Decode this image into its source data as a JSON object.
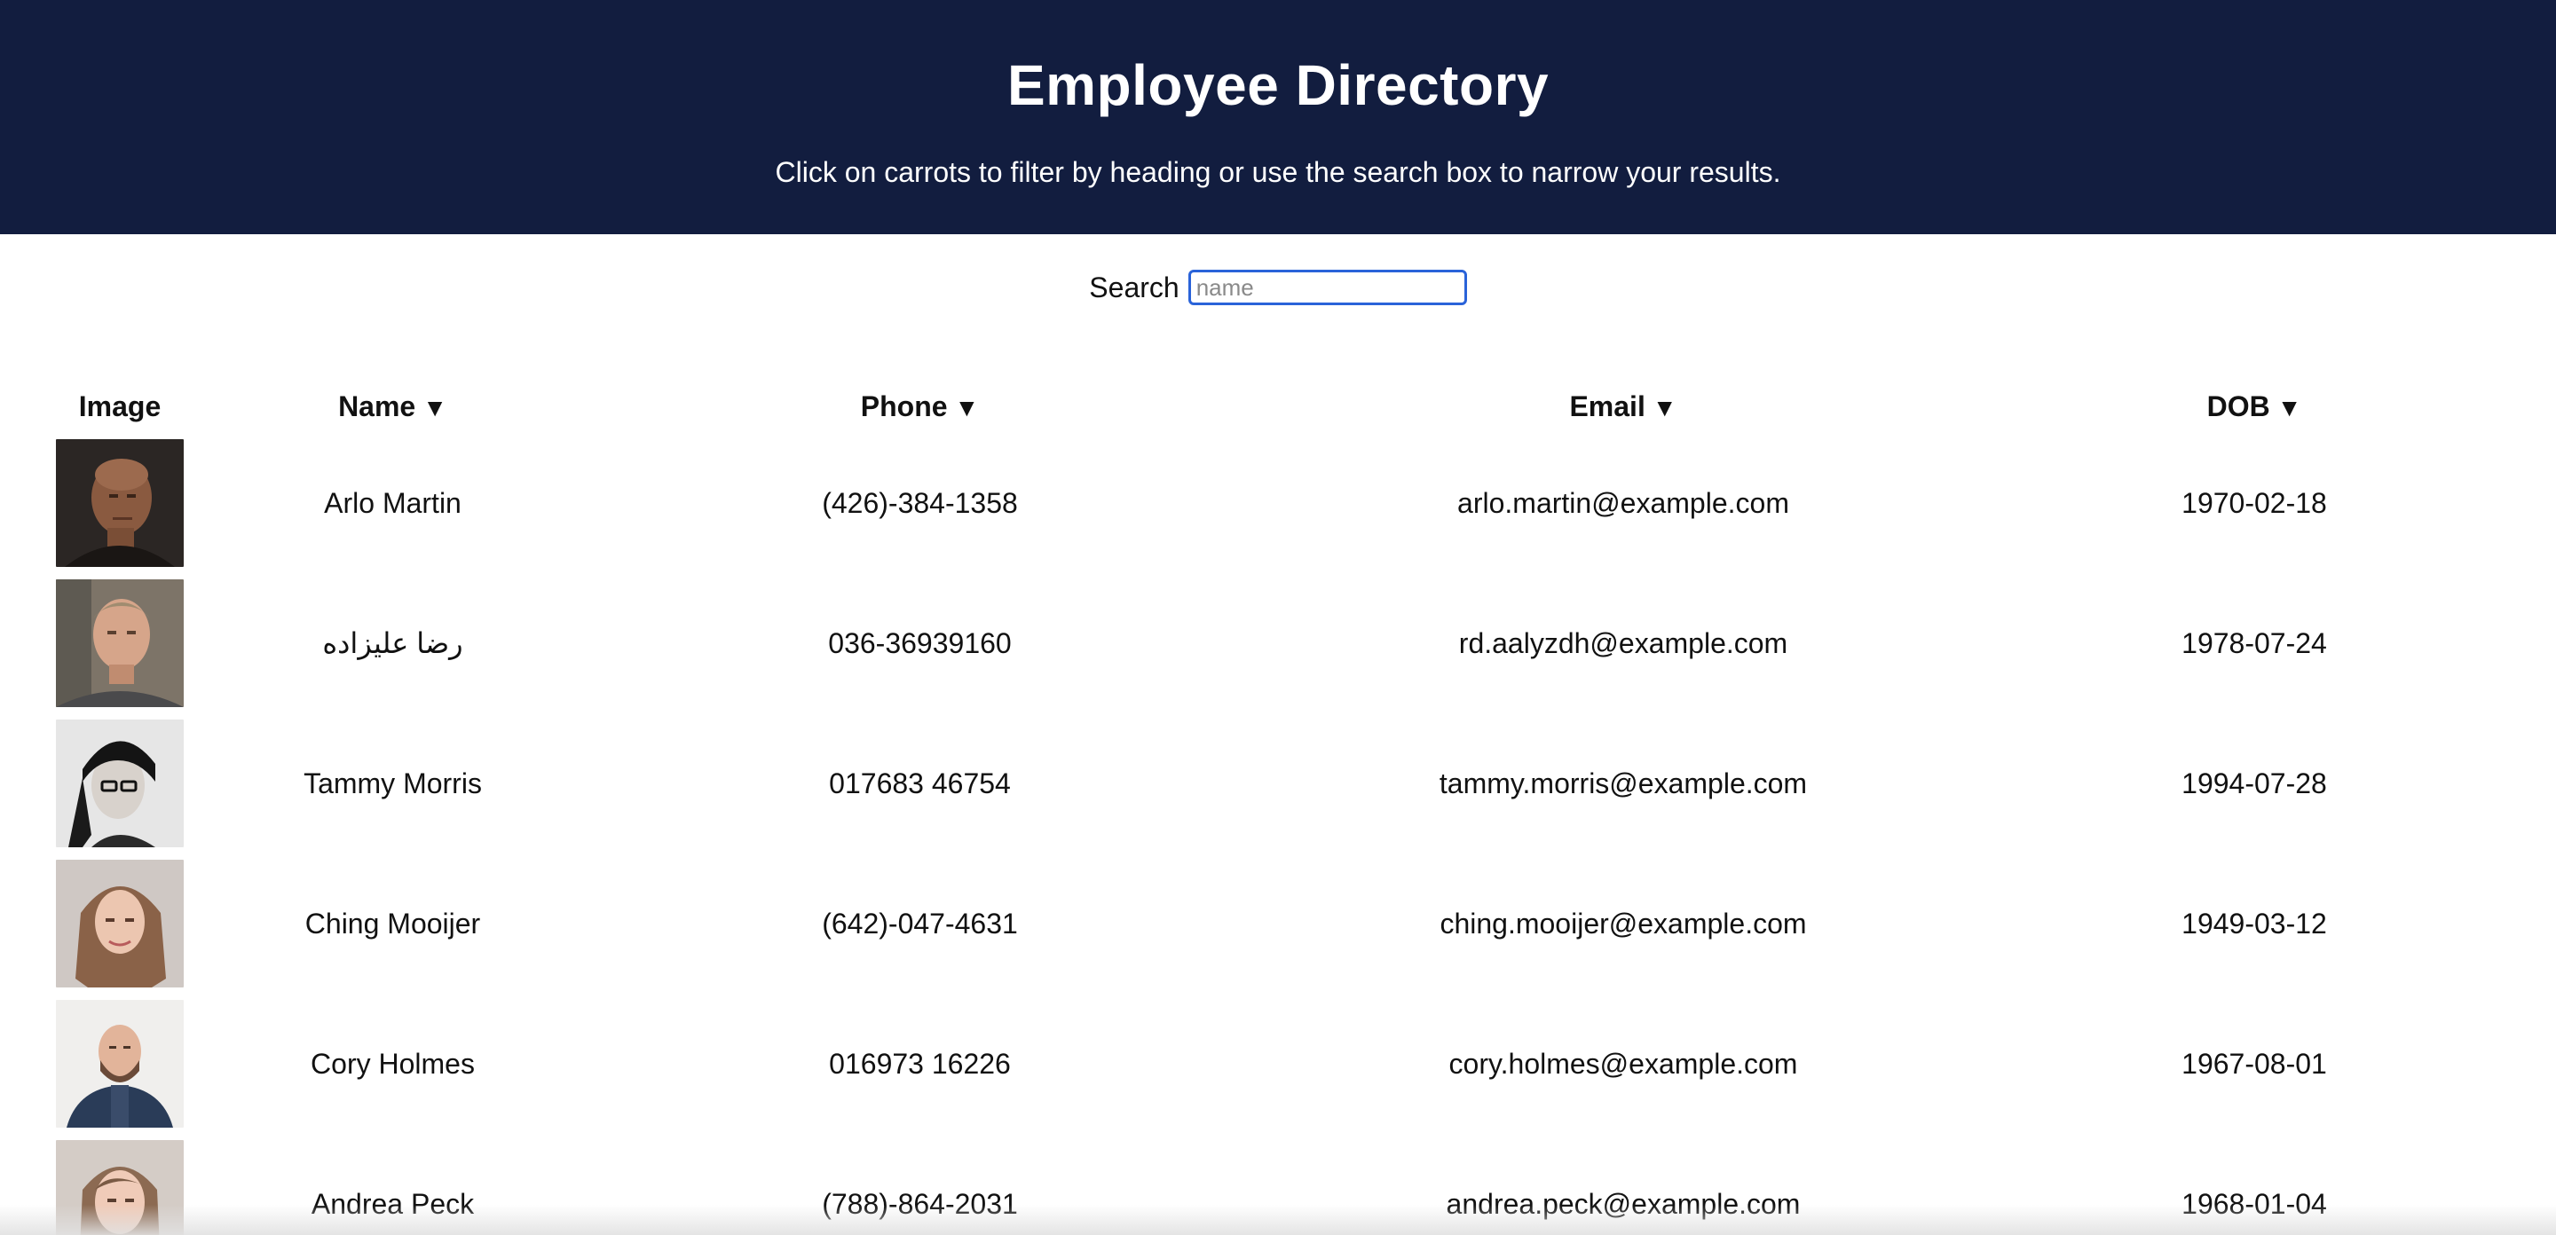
{
  "header": {
    "title": "Employee Directory",
    "subtitle": "Click on carrots to filter by heading or use the search box to narrow your results."
  },
  "search": {
    "label": "Search",
    "placeholder": "name",
    "value": ""
  },
  "table": {
    "columns": [
      {
        "label": "Image",
        "sortable": false
      },
      {
        "label": "Name",
        "sortable": true,
        "caret": "▼"
      },
      {
        "label": "Phone",
        "sortable": true,
        "caret": "▼"
      },
      {
        "label": "Email",
        "sortable": true,
        "caret": "▼"
      },
      {
        "label": "DOB",
        "sortable": true,
        "caret": "▼"
      }
    ],
    "rows": [
      {
        "name": "Arlo Martin",
        "phone": "(426)-384-1358",
        "email": "arlo.martin@example.com",
        "dob": "1970-02-18"
      },
      {
        "name": "رضا علیزاده",
        "phone": "036-36939160",
        "email": "rd.aalyzdh@example.com",
        "dob": "1978-07-24"
      },
      {
        "name": "Tammy Morris",
        "phone": "017683 46754",
        "email": "tammy.morris@example.com",
        "dob": "1994-07-28"
      },
      {
        "name": "Ching Mooijer",
        "phone": "(642)-047-4631",
        "email": "ching.mooijer@example.com",
        "dob": "1949-03-12"
      },
      {
        "name": "Cory Holmes",
        "phone": "016973 16226",
        "email": "cory.holmes@example.com",
        "dob": "1967-08-01"
      },
      {
        "name": "Andrea Peck",
        "phone": "(788)-864-2031",
        "email": "andrea.peck@example.com",
        "dob": "1968-01-04"
      }
    ]
  },
  "colors": {
    "header_bg": "#121d3f",
    "search_border": "#2a63d9"
  }
}
